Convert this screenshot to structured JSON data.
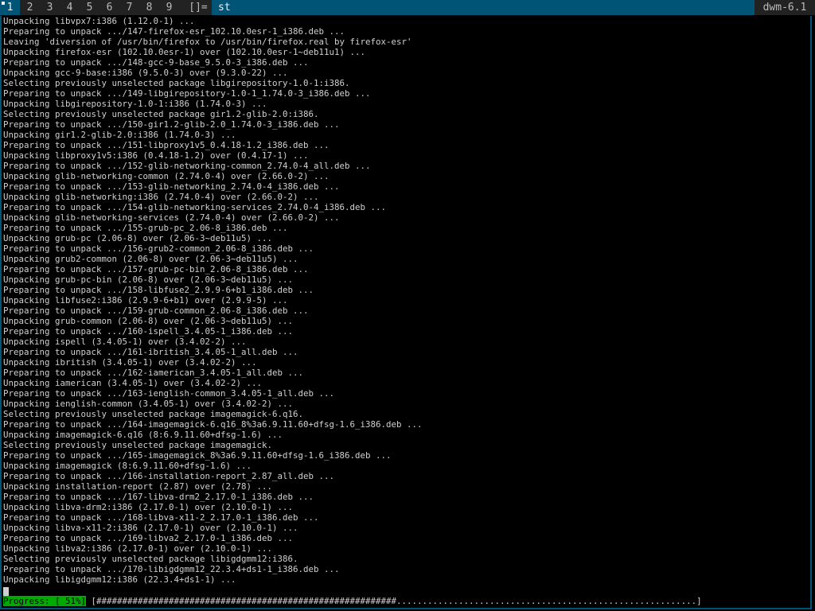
{
  "bar": {
    "tags": [
      "1",
      "2",
      "3",
      "4",
      "5",
      "6",
      "7",
      "8",
      "9"
    ],
    "selected_tag": "1",
    "layout_symbol": "[]=",
    "window_title": "st",
    "status": "dwm-6.1"
  },
  "terminal": {
    "lines": [
      "Unpacking libvpx7:i386 (1.12.0-1) ...",
      "Preparing to unpack .../147-firefox-esr_102.10.0esr-1_i386.deb ...",
      "Leaving 'diversion of /usr/bin/firefox to /usr/bin/firefox.real by firefox-esr'",
      "Unpacking firefox-esr (102.10.0esr-1) over (102.10.0esr-1~deb11u1) ...",
      "Preparing to unpack .../148-gcc-9-base_9.5.0-3_i386.deb ...",
      "Unpacking gcc-9-base:i386 (9.5.0-3) over (9.3.0-22) ...",
      "Selecting previously unselected package libgirepository-1.0-1:i386.",
      "Preparing to unpack .../149-libgirepository-1.0-1_1.74.0-3_i386.deb ...",
      "Unpacking libgirepository-1.0-1:i386 (1.74.0-3) ...",
      "Selecting previously unselected package gir1.2-glib-2.0:i386.",
      "Preparing to unpack .../150-gir1.2-glib-2.0_1.74.0-3_i386.deb ...",
      "Unpacking gir1.2-glib-2.0:i386 (1.74.0-3) ...",
      "Preparing to unpack .../151-libproxy1v5_0.4.18-1.2_i386.deb ...",
      "Unpacking libproxy1v5:i386 (0.4.18-1.2) over (0.4.17-1) ...",
      "Preparing to unpack .../152-glib-networking-common_2.74.0-4_all.deb ...",
      "Unpacking glib-networking-common (2.74.0-4) over (2.66.0-2) ...",
      "Preparing to unpack .../153-glib-networking_2.74.0-4_i386.deb ...",
      "Unpacking glib-networking:i386 (2.74.0-4) over (2.66.0-2) ...",
      "Preparing to unpack .../154-glib-networking-services_2.74.0-4_i386.deb ...",
      "Unpacking glib-networking-services (2.74.0-4) over (2.66.0-2) ...",
      "Preparing to unpack .../155-grub-pc_2.06-8_i386.deb ...",
      "Unpacking grub-pc (2.06-8) over (2.06-3~deb11u5) ...",
      "Preparing to unpack .../156-grub2-common_2.06-8_i386.deb ...",
      "Unpacking grub2-common (2.06-8) over (2.06-3~deb11u5) ...",
      "Preparing to unpack .../157-grub-pc-bin_2.06-8_i386.deb ...",
      "Unpacking grub-pc-bin (2.06-8) over (2.06-3~deb11u5) ...",
      "Preparing to unpack .../158-libfuse2_2.9.9-6+b1_i386.deb ...",
      "Unpacking libfuse2:i386 (2.9.9-6+b1) over (2.9.9-5) ...",
      "Preparing to unpack .../159-grub-common_2.06-8_i386.deb ...",
      "Unpacking grub-common (2.06-8) over (2.06-3~deb11u5) ...",
      "Preparing to unpack .../160-ispell_3.4.05-1_i386.deb ...",
      "Unpacking ispell (3.4.05-1) over (3.4.02-2) ...",
      "Preparing to unpack .../161-ibritish_3.4.05-1_all.deb ...",
      "Unpacking ibritish (3.4.05-1) over (3.4.02-2) ...",
      "Preparing to unpack .../162-iamerican_3.4.05-1_all.deb ...",
      "Unpacking iamerican (3.4.05-1) over (3.4.02-2) ...",
      "Preparing to unpack .../163-ienglish-common_3.4.05-1_all.deb ...",
      "Unpacking ienglish-common (3.4.05-1) over (3.4.02-2) ...",
      "Selecting previously unselected package imagemagick-6.q16.",
      "Preparing to unpack .../164-imagemagick-6.q16_8%3a6.9.11.60+dfsg-1.6_i386.deb ...",
      "Unpacking imagemagick-6.q16 (8:6.9.11.60+dfsg-1.6) ...",
      "Selecting previously unselected package imagemagick.",
      "Preparing to unpack .../165-imagemagick_8%3a6.9.11.60+dfsg-1.6_i386.deb ...",
      "Unpacking imagemagick (8:6.9.11.60+dfsg-1.6) ...",
      "Preparing to unpack .../166-installation-report_2.87_all.deb ...",
      "Unpacking installation-report (2.87) over (2.78) ...",
      "Preparing to unpack .../167-libva-drm2_2.17.0-1_i386.deb ...",
      "Unpacking libva-drm2:i386 (2.17.0-1) over (2.10.0-1) ...",
      "Preparing to unpack .../168-libva-x11-2_2.17.0-1_i386.deb ...",
      "Unpacking libva-x11-2:i386 (2.17.0-1) over (2.10.0-1) ...",
      "Preparing to unpack .../169-libva2_2.17.0-1_i386.deb ...",
      "Unpacking libva2:i386 (2.17.0-1) over (2.10.0-1) ...",
      "Selecting previously unselected package libigdgmm12:i386.",
      "Preparing to unpack .../170-libigdgmm12_22.3.4+ds1-1_i386.deb ...",
      "Unpacking libigdgmm12:i386 (22.3.4+ds1-1) ..."
    ],
    "progress": {
      "label": "Progress: [ 51%]",
      "bar": "[##########################################################..........................................................]",
      "fraction": 0.51
    }
  },
  "colors": {
    "bar_bg": "#222222",
    "bar_fg": "#bbbbbb",
    "selected_bg": "#005577",
    "selected_fg": "#eeeeee",
    "terminal_bg": "#000000",
    "terminal_fg": "#d0d0d0",
    "progress_label_bg": "#00aa00"
  }
}
